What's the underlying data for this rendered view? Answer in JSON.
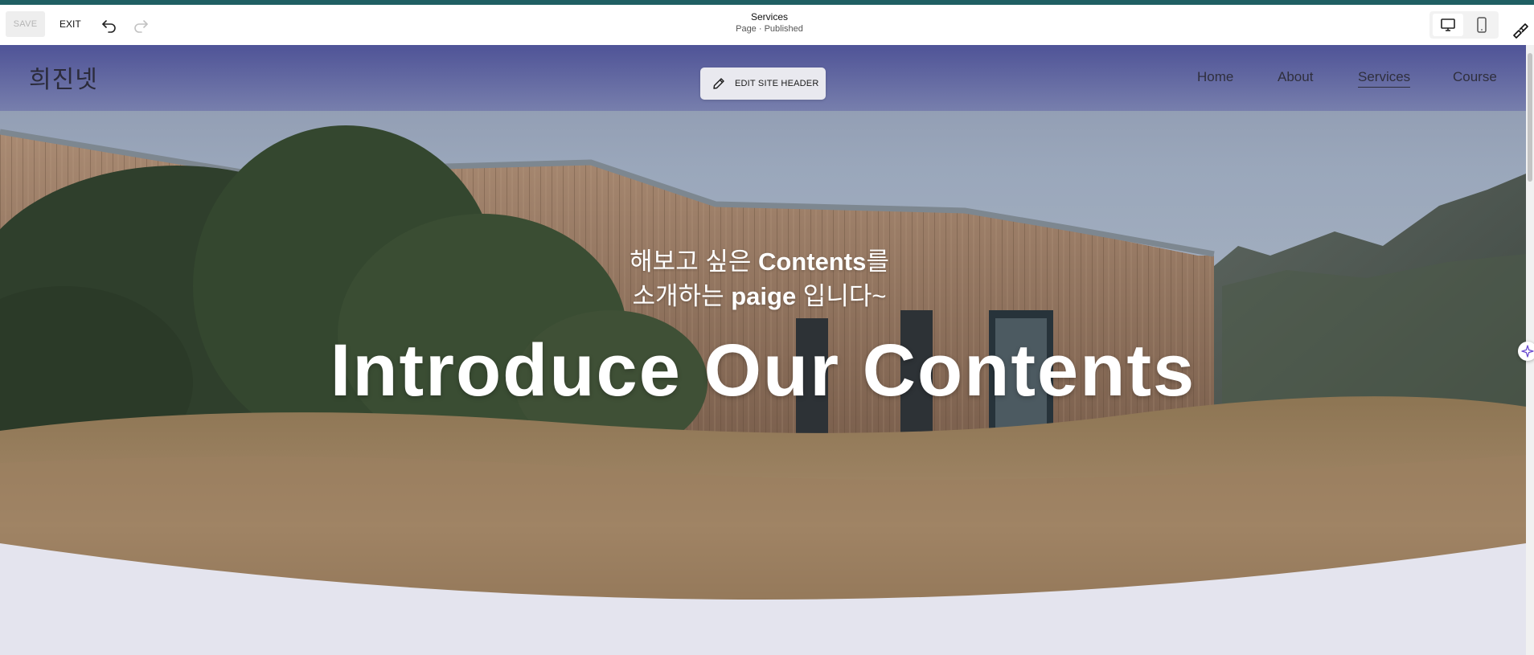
{
  "toolbar": {
    "save_label": "SAVE",
    "exit_label": "EXIT",
    "page_title": "Services",
    "page_status": "Page · Published",
    "undo_icon": "undo-icon",
    "redo_icon": "redo-icon",
    "desktop_icon": "desktop-icon",
    "mobile_icon": "mobile-icon",
    "brush_icon": "paint-brush-icon"
  },
  "site_header": {
    "logo": "희진넷",
    "edit_button_label": "EDIT SITE HEADER",
    "nav": [
      "Home",
      "About",
      "Services",
      "Course"
    ],
    "active_nav": "Services"
  },
  "hero": {
    "line1_prefix": "해보고 싶은 ",
    "line1_bold": "Contents",
    "line1_suffix": "를",
    "line2_prefix": "소개하는 ",
    "line2_bold": "paige",
    "line2_suffix": " 입니다~",
    "headline": "Introduce Our Contents"
  },
  "colors": {
    "top_stripe": "#1f5f63",
    "header_overlay": "#4c5096",
    "page_bg": "#e4e4ee"
  }
}
